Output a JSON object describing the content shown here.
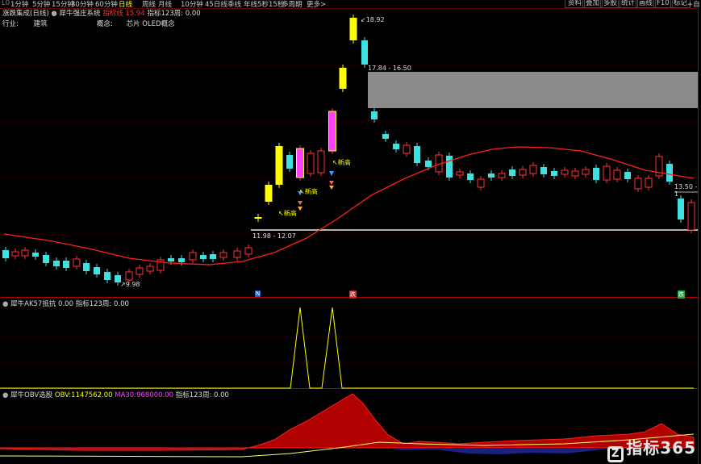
{
  "toolbar": {
    "items": [
      "1分钟",
      "5分钟",
      "15分钟",
      "30分钟",
      "60分钟",
      "日线",
      "周线",
      "月线",
      "10分钟",
      "45日线",
      "季线",
      "年线",
      "5秒",
      "15秒",
      "多周期",
      "更多>"
    ],
    "active_index": 5,
    "right_buttons": [
      "资料",
      "叠加",
      "多股",
      "统计",
      "画线",
      "F10",
      "标记"
    ],
    "left_glyph": "L0",
    "right_edge": "+自"
  },
  "main_panel": {
    "name": "涨跌集成(日线)",
    "indicator": "犀牛强庄系统",
    "tag": "指标线",
    "value1": "15.94",
    "value2_label": "指标123周:",
    "value2": "0.00",
    "industry_label": "行业:",
    "industry_value": "建筑",
    "concept_label": "概念:",
    "concept_value": "芯片 OLED概念",
    "price_high": "18.92",
    "price_low": "9.98",
    "range_upper": "17.84 - 16.50",
    "range_lower": "11.98 - 12.07",
    "range_right": "13.50 - 1",
    "signal_text": "↖新高",
    "markers": [
      "N",
      "跌",
      "跌"
    ]
  },
  "panel2": {
    "name": "犀牛AK57抵抗",
    "value": "0.00",
    "label2": "指标123周:",
    "value2": "0.00"
  },
  "panel3": {
    "name": "犀牛OBV选股",
    "obv_label": "OBV:",
    "obv_value": "1147562.00",
    "ma_label": "MA30:",
    "ma_value": "968000.00",
    "label3": "指标123周:",
    "value3": "0.00"
  },
  "watermark": {
    "logo": "Z",
    "text": "指标365"
  },
  "colors": {
    "up": "#ff3333",
    "down": "#40e0e0",
    "ma": "#ff2020",
    "signal": "#ffff00",
    "grid": "#8b0000"
  }
}
